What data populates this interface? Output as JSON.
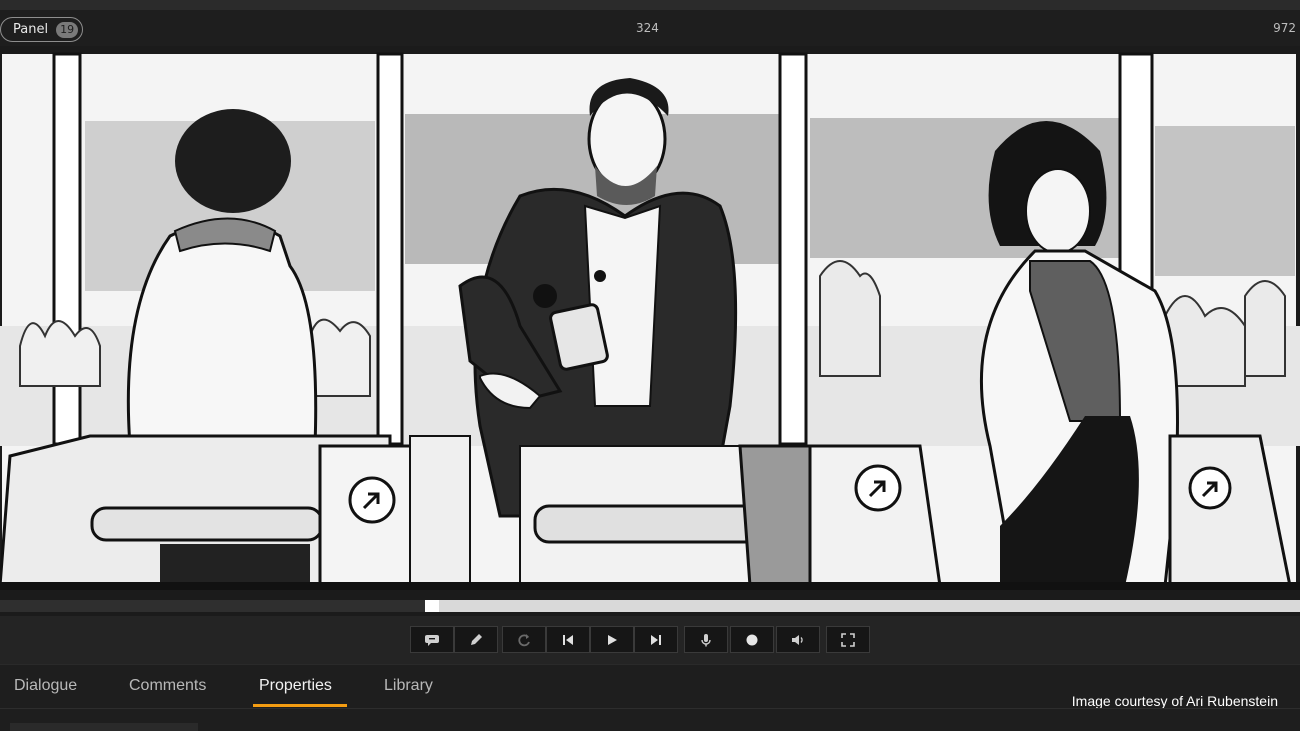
{
  "header": {
    "panel_label": "Panel",
    "panel_count": "19",
    "frame_mid": "324",
    "frame_end": "972"
  },
  "timeline": {
    "playhead_fraction": 0.333
  },
  "controls": [
    {
      "name": "comment-button",
      "icon": "speech-bubble-icon"
    },
    {
      "name": "draw-button",
      "icon": "pencil-icon"
    },
    {
      "name": "loop-button",
      "icon": "loop-icon"
    },
    {
      "name": "previous-button",
      "icon": "skip-back-icon"
    },
    {
      "name": "play-button",
      "icon": "play-icon"
    },
    {
      "name": "next-button",
      "icon": "skip-forward-icon"
    },
    {
      "name": "microphone-button",
      "icon": "microphone-icon"
    },
    {
      "name": "record-button",
      "icon": "record-icon"
    },
    {
      "name": "volume-button",
      "icon": "speaker-icon"
    },
    {
      "name": "fullscreen-button",
      "icon": "fullscreen-icon"
    }
  ],
  "tabs": [
    {
      "label": "Dialogue"
    },
    {
      "label": "Comments"
    },
    {
      "label": "Properties",
      "active": true
    },
    {
      "label": "Library"
    }
  ],
  "credit": "Image courtesy of Ari Rubenstein",
  "colors": {
    "accent": "#f39c12",
    "background": "#1e1e1e"
  }
}
